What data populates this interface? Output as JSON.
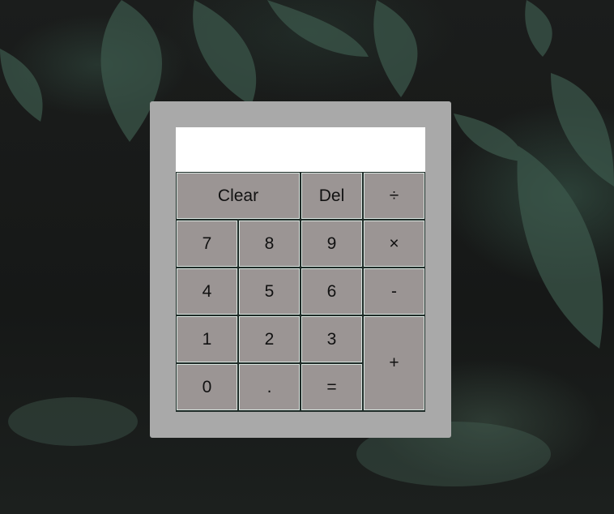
{
  "display": {
    "value": ""
  },
  "keys": {
    "clear": "Clear",
    "del": "Del",
    "divide": "÷",
    "seven": "7",
    "eight": "8",
    "nine": "9",
    "multiply": "×",
    "four": "4",
    "five": "5",
    "six": "6",
    "minus": "-",
    "one": "1",
    "two": "2",
    "three": "3",
    "plus": "+",
    "zero": "0",
    "decimal": ".",
    "equals": "="
  },
  "colors": {
    "calculator_body": "#a9a9a9",
    "display_background": "#ffffff",
    "key_background": "#9b9594",
    "key_border": "#d8e4df"
  }
}
